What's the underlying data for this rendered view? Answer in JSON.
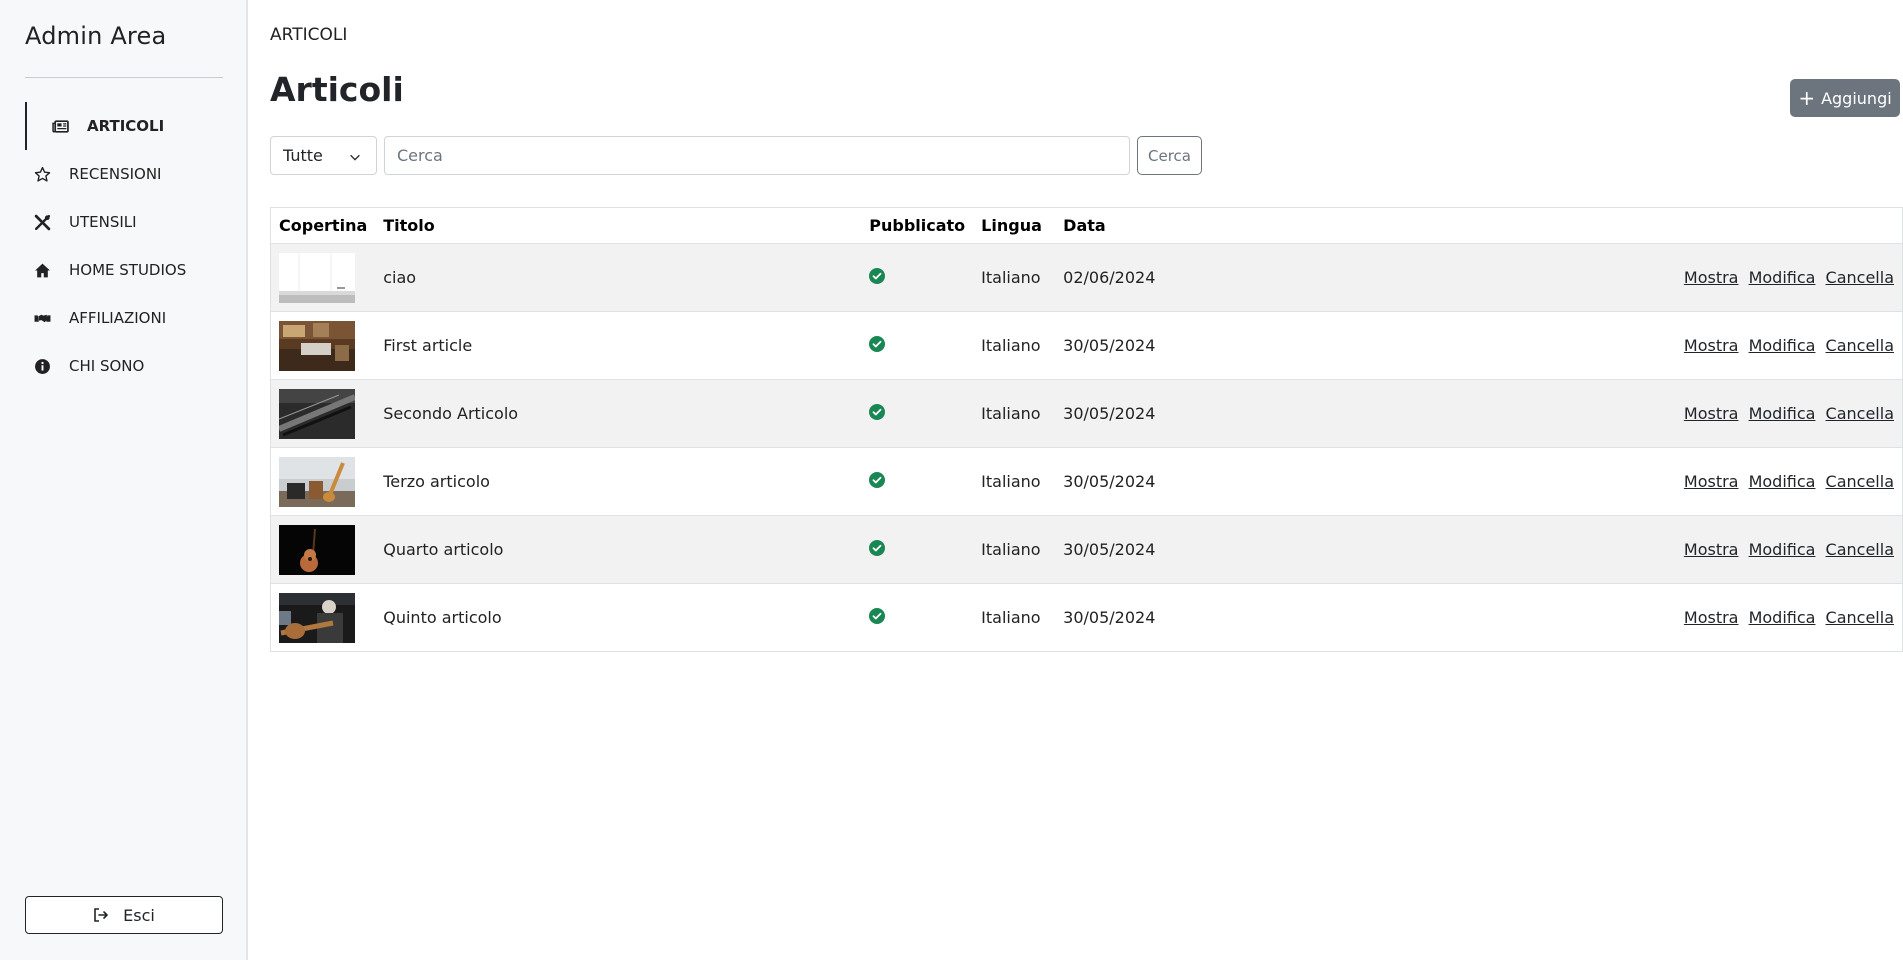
{
  "sidebar": {
    "brand": "Admin Area",
    "items": [
      {
        "label": "ARTICOLI",
        "icon": "newspaper-icon",
        "active": true
      },
      {
        "label": "RECENSIONI",
        "icon": "star-icon",
        "active": false
      },
      {
        "label": "UTENSILI",
        "icon": "tools-icon",
        "active": false
      },
      {
        "label": "HOME STUDIOS",
        "icon": "home-icon",
        "active": false
      },
      {
        "label": "AFFILIAZIONI",
        "icon": "handshake-icon",
        "active": false
      },
      {
        "label": "CHI SONO",
        "icon": "info-icon",
        "active": false
      }
    ],
    "logout_label": "Esci"
  },
  "header": {
    "breadcrumb": "ARTICOLI",
    "title": "Articoli",
    "add_label": "Aggiungi"
  },
  "filters": {
    "select_value": "Tutte",
    "search_placeholder": "Cerca",
    "search_button": "Cerca"
  },
  "table": {
    "columns": [
      "Copertina",
      "Titolo",
      "Pubblicato",
      "Lingua",
      "Data"
    ],
    "action_labels": {
      "show": "Mostra",
      "edit": "Modifica",
      "delete": "Cancella"
    },
    "rows": [
      {
        "title": "ciao",
        "published": true,
        "language": "Italiano",
        "date": "02/06/2024"
      },
      {
        "title": "First article",
        "published": true,
        "language": "Italiano",
        "date": "30/05/2024"
      },
      {
        "title": "Secondo Articolo",
        "published": true,
        "language": "Italiano",
        "date": "30/05/2024"
      },
      {
        "title": "Terzo articolo",
        "published": true,
        "language": "Italiano",
        "date": "30/05/2024"
      },
      {
        "title": "Quarto articolo",
        "published": true,
        "language": "Italiano",
        "date": "30/05/2024"
      },
      {
        "title": "Quinto articolo",
        "published": true,
        "language": "Italiano",
        "date": "30/05/2024"
      }
    ]
  },
  "colors": {
    "accent_gray": "#6c757d",
    "published_green": "#198754",
    "sidebar_bg": "#f7f8fa",
    "row_stripe": "#f2f2f2"
  }
}
